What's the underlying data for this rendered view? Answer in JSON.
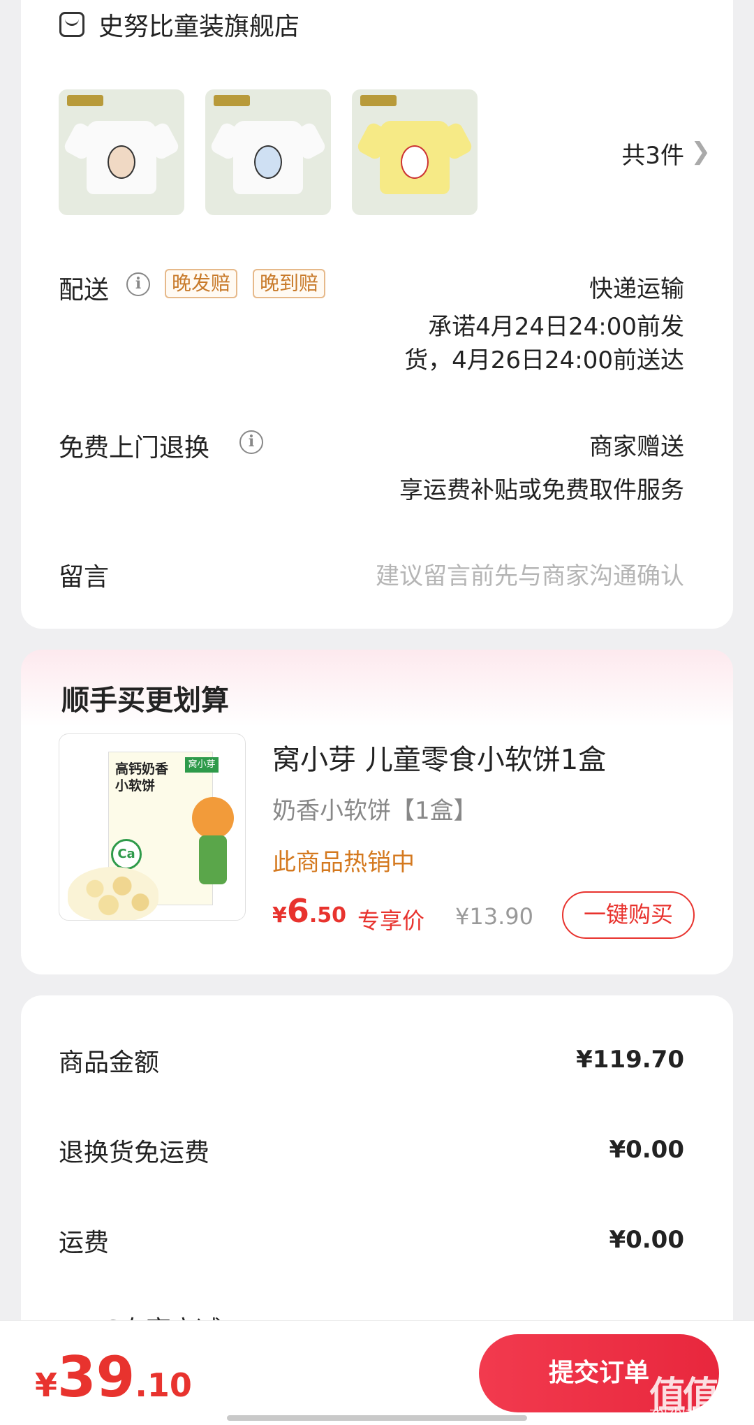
{
  "store": {
    "name": "史努比童装旗舰店",
    "item_count": "共3件"
  },
  "delivery": {
    "label": "配送",
    "tags": [
      "晚发赔",
      "晚到赔"
    ],
    "method": "快递运输",
    "promise_line1": "承诺4月24日24:00前发",
    "promise_line2": "货，4月26日24:00前送达"
  },
  "return_service": {
    "label": "免费上门退换",
    "value": "商家赠送",
    "desc": "享运费补贴或免费取件服务"
  },
  "message": {
    "label": "留言",
    "placeholder": "建议留言前先与商家沟通确认"
  },
  "addon": {
    "title": "顺手买更划算",
    "product_name": "窝小芽 儿童零食小软饼1盒",
    "spec": "奶香小软饼【1盒】",
    "hot": "此商品热销中",
    "price_currency": "¥",
    "price_int": "6",
    "price_dec": ".50",
    "exclusive_label": "专享价",
    "original_price": "¥13.90",
    "buy_button": "一键购买",
    "image_text": {
      "title": "高钙奶香\n小软饼",
      "brand": "窝小芽",
      "ca": "Ca"
    }
  },
  "summary": {
    "rows": [
      {
        "label": "商品金额",
        "value": "¥119.70"
      },
      {
        "label": "退换货免运费",
        "value": "¥0.00"
      },
      {
        "label": "运费",
        "value": "¥0.00"
      }
    ],
    "partial_label": "PLUS专享立减"
  },
  "footer": {
    "currency": "¥",
    "total_int": "39",
    "total_dec": ".10",
    "submit_label": "提交订单",
    "watermark": "值值值",
    "watermark_sub": "zhizhizhi.com"
  },
  "colors": {
    "accent_red": "#e8332e",
    "tag_orange": "#c87a2a",
    "hot_orange": "#d4791f"
  },
  "icons": [
    "store-icon",
    "info-icon",
    "chevron-right-icon"
  ]
}
